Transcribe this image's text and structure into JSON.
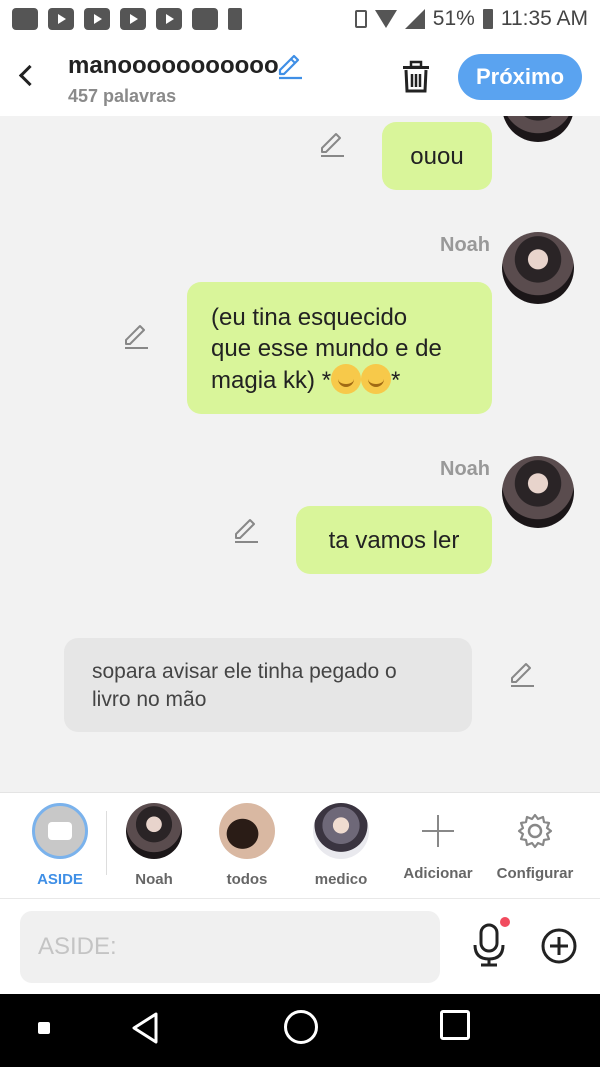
{
  "status_bar": {
    "battery": "51%",
    "time": "11:35 AM"
  },
  "header": {
    "title": "manooooooooooo",
    "word_count": "457 palavras",
    "next_label": "Próximo"
  },
  "messages": [
    {
      "speaker": "",
      "text": "ouou"
    },
    {
      "speaker": "Noah",
      "text_lines": [
        "(eu tina esquecido",
        "que esse mundo e de",
        "magia kk) *"
      ],
      "suffix": "*"
    },
    {
      "speaker": "Noah",
      "text": "ta vamos ler"
    }
  ],
  "aside_message": {
    "line1": "sopara avisar ele tinha pegado o",
    "line2": "livro no mão"
  },
  "characters": [
    {
      "label": "ASIDE",
      "active": true
    },
    {
      "label": "Noah"
    },
    {
      "label": "todos"
    },
    {
      "label": "medico"
    },
    {
      "label": "Adicionar"
    },
    {
      "label": "Configurar"
    }
  ],
  "composer": {
    "placeholder": "ASIDE:"
  },
  "colors": {
    "accent": "#5aa3f0",
    "bubble": "#d9f59a",
    "aside_bubble": "#e6e6e6",
    "mic_dot": "#f14b5e"
  }
}
